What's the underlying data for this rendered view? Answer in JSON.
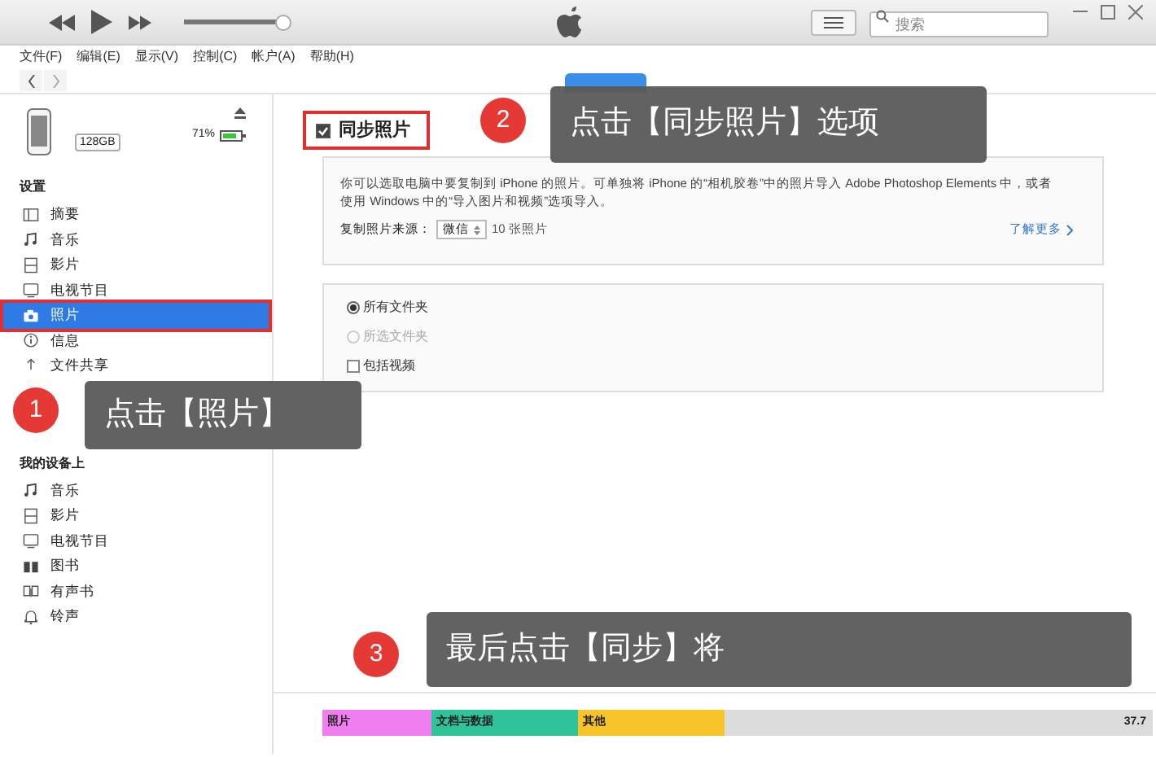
{
  "volume": {
    "level": 0.95
  },
  "search": {
    "placeholder": "搜索"
  },
  "menu": [
    "文件(F)",
    "编辑(E)",
    "显示(V)",
    "控制(C)",
    "帐户(A)",
    "帮助(H)"
  ],
  "device": {
    "capacity": "128GB",
    "battery": "71%"
  },
  "sidebar": [
    {
      "heading": "设置",
      "items": [
        {
          "label": "摘要",
          "selected": false
        },
        {
          "label": "音乐",
          "selected": false
        },
        {
          "label": "影片",
          "selected": false
        },
        {
          "label": "电视节目",
          "selected": false
        },
        {
          "label": "照片",
          "selected": true
        },
        {
          "label": "信息",
          "selected": false
        },
        {
          "label": "文件共享",
          "selected": false
        }
      ]
    },
    {
      "heading": "我的设备上",
      "items": [
        {
          "label": "音乐",
          "selected": false
        },
        {
          "label": "影片",
          "selected": false
        },
        {
          "label": "电视节目",
          "selected": false
        },
        {
          "label": "图书",
          "selected": false
        },
        {
          "label": "有声书",
          "selected": false
        },
        {
          "label": "铃声",
          "selected": false
        }
      ]
    }
  ],
  "sync": {
    "label": "同步照片",
    "checked": true
  },
  "description": "你可以选取电脑中要复制到 iPhone 的照片。可单独将 iPhone 的“相机胶卷”中的照片导入 Adobe Photoshop Elements 中，或者使用 Windows 中的“导入图片和视频”选项导入。",
  "source": {
    "label": "复制照片来源：",
    "value": "微信",
    "count": "10 张照片",
    "link": "了解更多"
  },
  "options": [
    {
      "kind": "radio",
      "label": "所有文件夹",
      "selected": true,
      "disabled": false
    },
    {
      "kind": "radio",
      "label": "所选文件夹",
      "selected": false,
      "disabled": true
    },
    {
      "kind": "checkbox",
      "label": "包括视频",
      "checked": false,
      "disabled": false
    }
  ],
  "storage": [
    {
      "label": "照片",
      "color": "#f07ef0"
    },
    {
      "label": "文档与数据",
      "color": "#2fc39a"
    },
    {
      "label": "其他",
      "color": "#f7c52a"
    },
    {
      "label": "37.7",
      "color": "#dcdcdc"
    }
  ],
  "callouts": [
    {
      "number": "1",
      "text": "点击【照片】"
    },
    {
      "number": "2",
      "text": "点击【同步照片】选项"
    },
    {
      "number": "3",
      "text": "最后点击【同步】将"
    }
  ]
}
